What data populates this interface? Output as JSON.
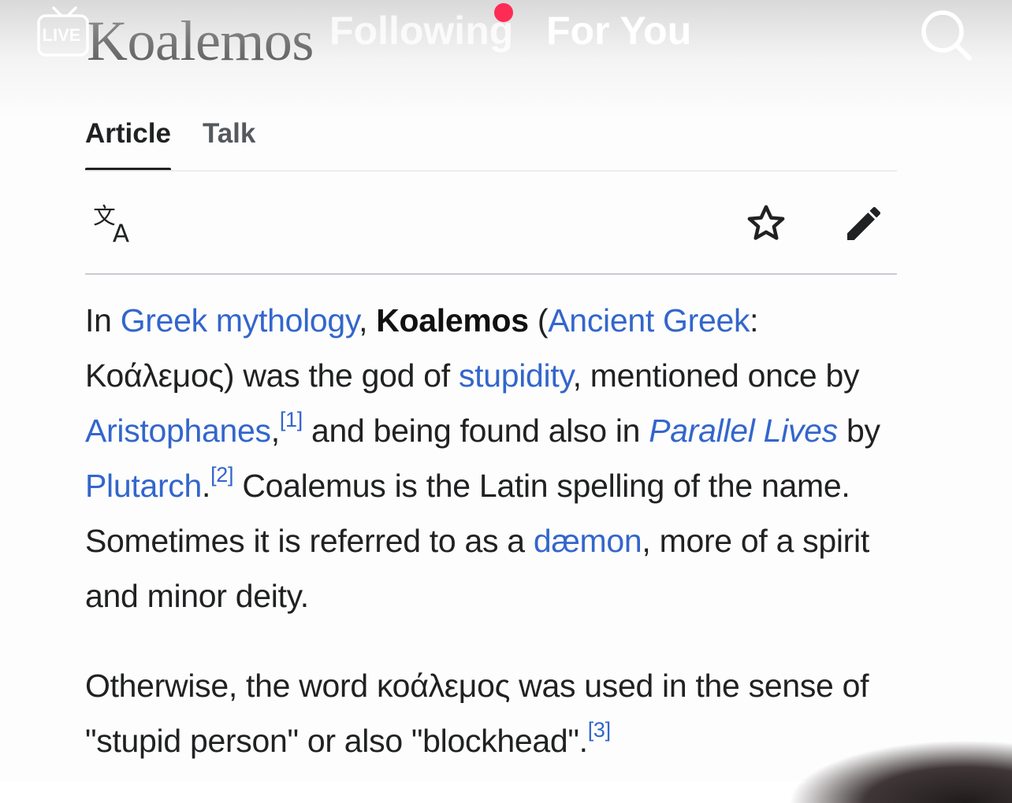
{
  "wiki": {
    "title": "Koalemos",
    "tabs": [
      "Article",
      "Talk"
    ],
    "active_tab": "Article",
    "toolbar": {
      "language_icon": "translate-icon",
      "watch_icon": "star-icon",
      "edit_icon": "pencil-icon"
    },
    "paragraph1": {
      "t1": "In ",
      "link_greek_mythology": "Greek mythology",
      "t2": ", ",
      "bold_name": "Koalemos",
      "t3": " (",
      "link_ancient_greek": "Ancient Greek",
      "t4": ": Κοάλεμος) was the god of ",
      "link_stupidity": "stupidity",
      "t5": ", mentioned once by ",
      "link_aristophanes": "Aristophanes",
      "t6": ",",
      "ref1": "[1]",
      "t7": " and being found also in ",
      "link_parallel_lives": "Parallel Lives",
      "t8": " by ",
      "link_plutarch": "Plutarch",
      "t9": ".",
      "ref2": "[2]",
      "t10": " Coalemus is the Latin spelling of the name. Sometimes it is referred to as a ",
      "link_daemon": "dæmon",
      "t11": ", more of a spirit and minor deity."
    },
    "paragraph2": {
      "t1": "Otherwise, the word κοάλεμος was used in the sense of \"stupid person\" or also \"blockhead\".",
      "ref3": "[3]"
    },
    "colors": {
      "link": "#3366cc",
      "text": "#202122"
    }
  },
  "overlay": {
    "live_label": "LIVE",
    "live_icon": "tv-icon",
    "feed_tabs": {
      "following": "Following",
      "for_you": "For You"
    },
    "active_feed": "For You",
    "search_icon": "search-icon",
    "colors": {
      "notification_dot": "#fe2c55"
    }
  }
}
